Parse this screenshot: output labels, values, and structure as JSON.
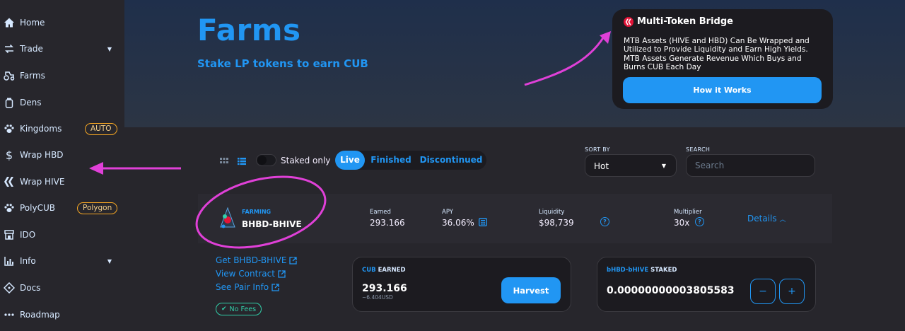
{
  "sidebar": {
    "items": [
      {
        "label": "Home",
        "icon": "home-icon"
      },
      {
        "label": "Trade",
        "icon": "swap-icon"
      },
      {
        "label": "Farms",
        "icon": "tractor-icon"
      },
      {
        "label": "Dens",
        "icon": "jar-icon"
      },
      {
        "label": "Kingdoms",
        "icon": "paw-icon",
        "badge": "AUTO"
      },
      {
        "label": "Wrap HBD",
        "icon": "dollar-icon"
      },
      {
        "label": "Wrap HIVE",
        "icon": "hive-icon"
      },
      {
        "label": "PolyCUB",
        "icon": "paw-icon",
        "badge": "Polygon"
      },
      {
        "label": "IDO",
        "icon": "shop-icon"
      },
      {
        "label": "Info",
        "icon": "chart-icon"
      },
      {
        "label": "Docs",
        "icon": "ticket-icon"
      },
      {
        "label": "Roadmap",
        "icon": "dots-icon"
      }
    ]
  },
  "hero": {
    "title": "Farms",
    "subtitle": "Stake LP tokens to earn CUB"
  },
  "bridge": {
    "title": "Multi-Token Bridge",
    "text": "MTB Assets (HIVE and HBD) Can Be Wrapped and Utilized to Provide Liquidity and Earn High Yields. MTB Assets Generate Revenue Which Buys and Burns CUB Each Day",
    "button": "How it Works"
  },
  "controls": {
    "staked_only": "Staked only",
    "tabs": [
      "Live",
      "Finished",
      "Discontinued"
    ],
    "sort_label": "SORT BY",
    "sort_value": "Hot",
    "search_label": "SEARCH",
    "search_placeholder": "Search"
  },
  "farm": {
    "tag": "FARMING",
    "pair": "BHBD-BHIVE",
    "earned_label": "Earned",
    "earned_value": "293.166",
    "apy_label": "APY",
    "apy_value": "36.06%",
    "liquidity_label": "Liquidity",
    "liquidity_value": "$98,739",
    "multiplier_label": "Multiplier",
    "multiplier_value": "30x",
    "details": "Details"
  },
  "detail": {
    "links": [
      "Get BHBD-BHIVE",
      "View Contract",
      "See Pair Info"
    ],
    "no_fees": "No Fees",
    "earned_title_a": "CUB",
    "earned_title_b": "EARNED",
    "earned_value": "293.166",
    "earned_usd": "~6.404USD",
    "harvest": "Harvest",
    "staked_title_a": "bHBD-bHIVE",
    "staked_title_b": "STAKED",
    "staked_value": "0.00000000003805583",
    "minus": "−",
    "plus": "+"
  },
  "colors": {
    "accent": "#2196f3",
    "badge": "#f5a623",
    "annotation": "#e040d8",
    "no_fees": "#31d0aa"
  }
}
